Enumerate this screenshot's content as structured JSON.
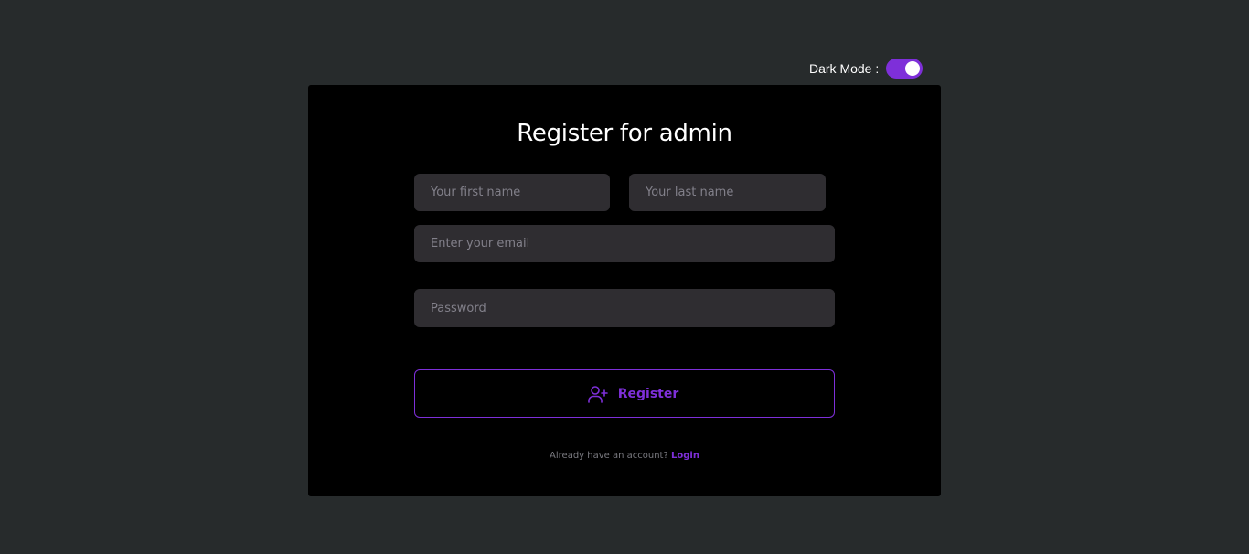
{
  "theme": {
    "background": "#272b2c",
    "card_background": "#000000",
    "accent": "#7e2fd9",
    "input_background": "#2f2d31"
  },
  "dark_mode": {
    "label": "Dark Mode :",
    "enabled": true
  },
  "form": {
    "title": "Register for admin",
    "first_name": {
      "placeholder": "Your first name",
      "value": ""
    },
    "last_name": {
      "placeholder": "Your last name",
      "value": ""
    },
    "email": {
      "placeholder": "Enter your email",
      "value": ""
    },
    "password": {
      "placeholder": "Password",
      "value": ""
    },
    "submit": {
      "label": "Register",
      "icon": "user-plus-icon"
    }
  },
  "footer": {
    "prompt": "Already have an account?",
    "link_label": "Login"
  }
}
